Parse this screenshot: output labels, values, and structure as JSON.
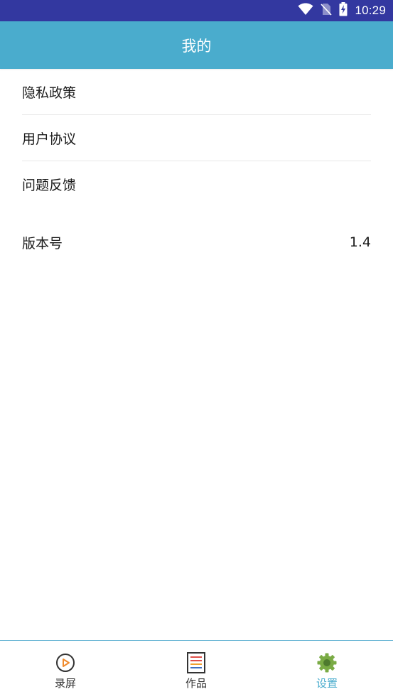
{
  "status_bar": {
    "time": "10:29",
    "bg_color": "#3338a0",
    "icons": [
      "wifi-icon",
      "no-sim-icon",
      "battery-charging-icon"
    ]
  },
  "header": {
    "title": "我的",
    "bg_color": "#4aaccd"
  },
  "menu": {
    "items": [
      {
        "label": "隐私政策"
      },
      {
        "label": "用户协议"
      },
      {
        "label": "问题反馈"
      }
    ]
  },
  "version": {
    "label": "版本号",
    "value": "1.4"
  },
  "bottom_nav": {
    "active_color": "#4aaccd",
    "items": [
      {
        "label": "录屏",
        "icon": "record-play-icon",
        "active": false
      },
      {
        "label": "作品",
        "icon": "works-list-icon",
        "active": false
      },
      {
        "label": "设置",
        "icon": "settings-gear-icon",
        "active": true
      }
    ]
  }
}
